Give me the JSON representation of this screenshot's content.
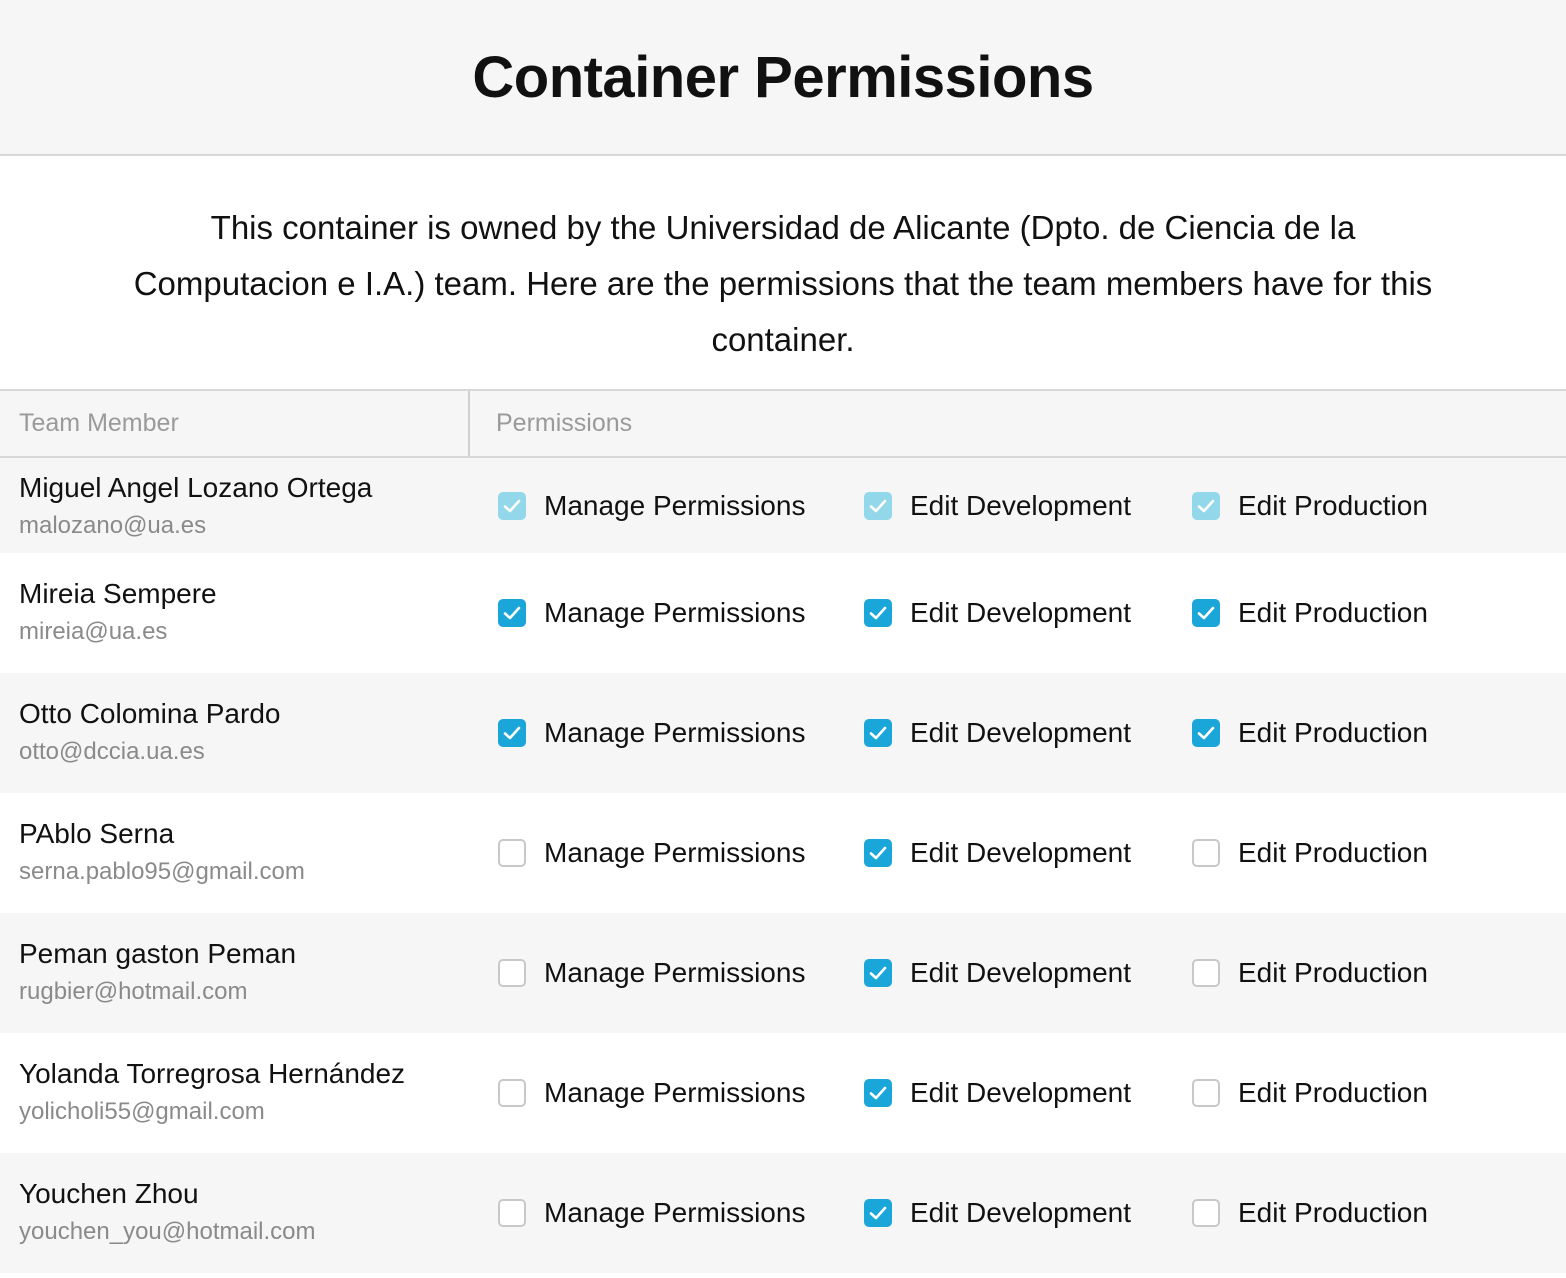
{
  "page": {
    "title": "Container Permissions",
    "description": "This container is owned by the Universidad de Alicante (Dpto. de Ciencia de la Computacion e I.A.) team. Here are the permissions that the team members have for this container."
  },
  "table": {
    "columns": [
      "Team Member",
      "Permissions"
    ],
    "permission_labels": [
      "Manage Permissions",
      "Edit Development",
      "Edit Production"
    ],
    "rows": [
      {
        "name": "Miguel Angel Lozano Ortega",
        "email": "malozano@ua.es",
        "manage": true,
        "development": true,
        "production": true,
        "disabled": true
      },
      {
        "name": "Mireia Sempere",
        "email": "mireia@ua.es",
        "manage": true,
        "development": true,
        "production": true,
        "disabled": false
      },
      {
        "name": "Otto Colomina Pardo",
        "email": "otto@dccia.ua.es",
        "manage": true,
        "development": true,
        "production": true,
        "disabled": false
      },
      {
        "name": "PAblo Serna",
        "email": "serna.pablo95@gmail.com",
        "manage": false,
        "development": true,
        "production": false,
        "disabled": false
      },
      {
        "name": "Peman gaston Peman",
        "email": "rugbier@hotmail.com",
        "manage": false,
        "development": true,
        "production": false,
        "disabled": false
      },
      {
        "name": "Yolanda Torregrosa Hernández",
        "email": "yolicholi55@gmail.com",
        "manage": false,
        "development": true,
        "production": false,
        "disabled": false
      },
      {
        "name": "Youchen Zhou",
        "email": "youchen_you@hotmail.com",
        "manage": false,
        "development": true,
        "production": false,
        "disabled": false
      }
    ]
  },
  "colors": {
    "checked": "#1aa6d8",
    "checked_disabled": "#93d7ea",
    "unchecked_border": "#c8c8c8",
    "header_bg": "#f6f6f6"
  }
}
